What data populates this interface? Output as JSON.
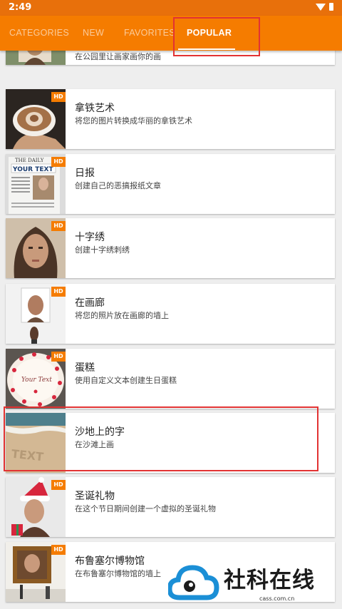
{
  "status": {
    "time": "2:49"
  },
  "tabs": [
    {
      "label": "CATEGORIES"
    },
    {
      "label": "NEW"
    },
    {
      "label": "FAVORITES"
    },
    {
      "label": "POPULAR"
    }
  ],
  "items": [
    {
      "title": "",
      "subtitle": "在公园里让画家画你的画",
      "hd": ""
    },
    {
      "title": "拿铁艺术",
      "subtitle": "将您的图片转换成华丽的拿铁艺术",
      "hd": "HD"
    },
    {
      "title": "日报",
      "subtitle": "创建自己的恶搞报纸文章",
      "hd": "HD"
    },
    {
      "title": "十字绣",
      "subtitle": "创建十字绣刺绣",
      "hd": "HD"
    },
    {
      "title": "在画廊",
      "subtitle": "将您的照片放在画廊的墙上",
      "hd": "HD"
    },
    {
      "title": "蛋糕",
      "subtitle": "使用自定义文本创建生日蛋糕",
      "hd": "HD"
    },
    {
      "title": "沙地上的字",
      "subtitle": "在沙滩上画",
      "hd": ""
    },
    {
      "title": "圣诞礼物",
      "subtitle": "在这个节日期间创建一个虚拟的圣诞礼物",
      "hd": "HD"
    },
    {
      "title": "布鲁塞尔博物馆",
      "subtitle": "在布鲁塞尔博物馆的墙上",
      "hd": "HD"
    }
  ],
  "thumb_texts": {
    "newspaper_masthead": "THE DAILY",
    "newspaper_headline": "YOUR TEXT",
    "cake_text": "Your Text",
    "sand_text": "TEXT"
  },
  "watermark": {
    "text": "社科在线",
    "url": "cass.com.cn"
  },
  "colors": {
    "primary": "#f57c00",
    "statusbar": "#e8700b",
    "highlight": "#e23333"
  }
}
